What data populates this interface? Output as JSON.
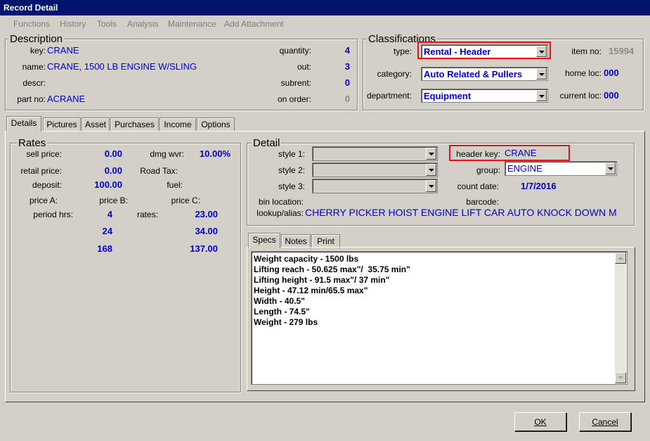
{
  "window": {
    "title": "Record Detail"
  },
  "menu": [
    "Functions",
    "History",
    "Tools",
    "Analysis",
    "Maintenance",
    "Add Attachment"
  ],
  "description": {
    "legend": "Description",
    "key_label": "key:",
    "key": "CRANE",
    "name_label": "name:",
    "name": "CRANE, 1500 LB ENGINE W/SLING",
    "descr_label": "descr:",
    "descr": "",
    "partno_label": "part no:",
    "partno": "ACRANE",
    "quantity_label": "quantity:",
    "quantity": "4",
    "out_label": "out:",
    "out": "3",
    "subrent_label": "subrent:",
    "subrent": "0",
    "onorder_label": "on order:",
    "onorder": "0"
  },
  "classifications": {
    "legend": "Classifications",
    "type_label": "type:",
    "type": "Rental - Header",
    "category_label": "category:",
    "category": "Auto Related & Pullers",
    "department_label": "department:",
    "department": "Equipment",
    "itemno_label": "item no:",
    "itemno": "15994",
    "homeloc_label": "home loc:",
    "homeloc": "000",
    "currentloc_label": "current loc:",
    "currentloc": "000"
  },
  "tabs": [
    "Details",
    "Pictures",
    "Asset",
    "Purchases",
    "Income",
    "Options"
  ],
  "rates": {
    "legend": "Rates",
    "sell_label": "sell price:",
    "sell": "0.00",
    "dmg_label": "dmg wvr:",
    "dmg": "10.00%",
    "retail_label": "retail price:",
    "retail": "0.00",
    "roadtax_label": "Road Tax:",
    "deposit_label": "deposit:",
    "deposit": "100.00",
    "fuel_label": "fuel:",
    "priceA_label": "price A:",
    "priceB_label": "price B:",
    "priceC_label": "price C:",
    "period_label": "period hrs:",
    "rates_label": "rates:",
    "rows": [
      {
        "hrs": "4",
        "rate": "23.00"
      },
      {
        "hrs": "24",
        "rate": "34.00"
      },
      {
        "hrs": "168",
        "rate": "137.00"
      }
    ]
  },
  "detail": {
    "legend": "Detail",
    "style1_label": "style 1:",
    "style2_label": "style 2:",
    "style3_label": "style 3:",
    "headerkey_label": "header key:",
    "headerkey": "CRANE",
    "group_label": "group:",
    "group": "ENGINE",
    "countdate_label": "count date:",
    "countdate": "1/7/2016",
    "binloc_label": "bin location:",
    "barcode_label": "barcode:",
    "lookup_label": "lookup/alias:",
    "lookup": "CHERRY PICKER HOIST ENGINE LIFT CAR AUTO KNOCK DOWN M"
  },
  "subtabs": [
    "Specs",
    "Notes",
    "Print"
  ],
  "specs": [
    "Weight capacity - 1500 lbs",
    "Lifting reach - 50.625 max\"/  35.75 min\"",
    "Lifting height - 91.5 max\"/ 37 min\"",
    "Height - 47.12 min/65.5 max\"",
    "Width - 40.5\"",
    "Length - 74.5\"",
    "Weight - 279 lbs"
  ],
  "buttons": {
    "ok": "OK",
    "cancel": "Cancel"
  }
}
